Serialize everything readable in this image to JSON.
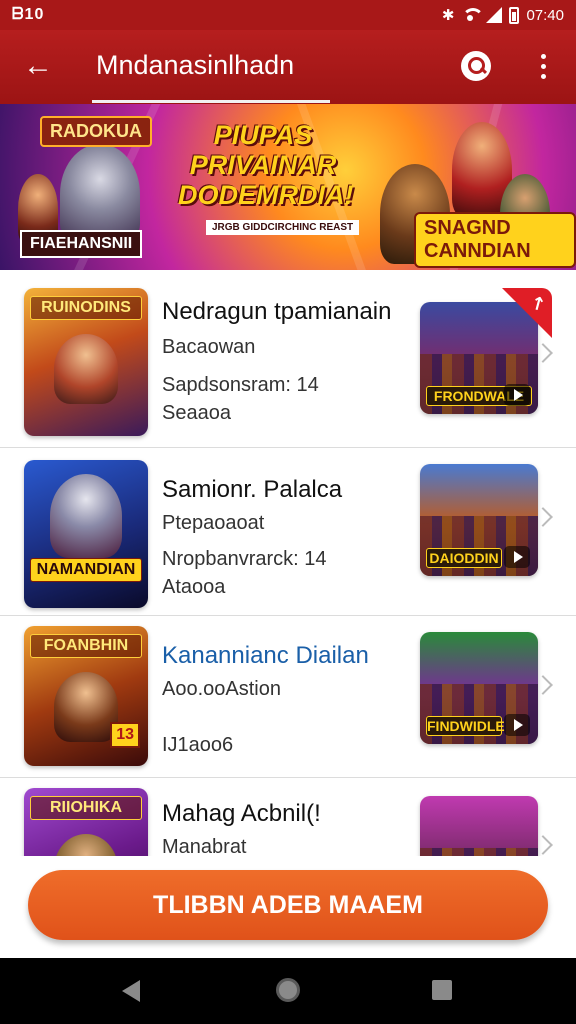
{
  "status_bar": {
    "time_left": "ᗷ10",
    "time_right": "07:40",
    "bluetooth_icon": "bluetooth-icon",
    "wifi_icon": "wifi-icon",
    "signal_icon": "signal-icon",
    "battery_icon": "battery-icon"
  },
  "app_bar": {
    "title": "Mndanasinlhadn",
    "back_icon": "arrow-left-icon",
    "search_icon": "search-icon",
    "more_icon": "more-vertical-icon",
    "color": "#a81818"
  },
  "banner": {
    "left_logo": "RADOKUA",
    "left_subtitle": "FIAEHANSNII",
    "headline": "PIUPAS PRIVAINAR DODEMRDIA!",
    "strip": "JRGB GIDDCIRCHINC REAST",
    "right_logo": "SNAGND CANNDIAN"
  },
  "list": {
    "items": [
      {
        "title": "Nedragun tpamianain",
        "line1": "Bacaowan",
        "line2": "Sapdsonsram: 14",
        "line3": "Seaaoa",
        "thumb_label": "RUINODINS",
        "side_label": "FRONDWALE",
        "title_color": "#111111"
      },
      {
        "title": "Samionr. Palalca",
        "line1": "Ptepaoaoat",
        "line2": "Nropbanvrarck: 14",
        "line3": "Ataooa",
        "thumb_label": "NAMANDIAN",
        "side_label": "DAIODDIN",
        "title_color": "#111111"
      },
      {
        "title": "Kanannianc Diailan",
        "line1": "Aoo.ooAstion",
        "line2": "",
        "line3": "IJ1aoo6",
        "thumb_label": "FOANBHIN",
        "side_label": "FINDWIDLE",
        "badge": "13",
        "title_color": "#1a5fa8"
      },
      {
        "title": "Mahag Acbnil(!",
        "line1": "Manabrat",
        "line2": "",
        "line3": "",
        "thumb_label": "RIIOHIKA",
        "side_label": "",
        "title_color": "#111111"
      }
    ]
  },
  "cta": {
    "label": "TLIBBN ADEB MAAEM",
    "color": "#e75c20"
  },
  "nav_bar": {
    "back_icon": "nav-back-icon",
    "home_icon": "nav-home-icon",
    "recents_icon": "nav-recents-icon"
  }
}
